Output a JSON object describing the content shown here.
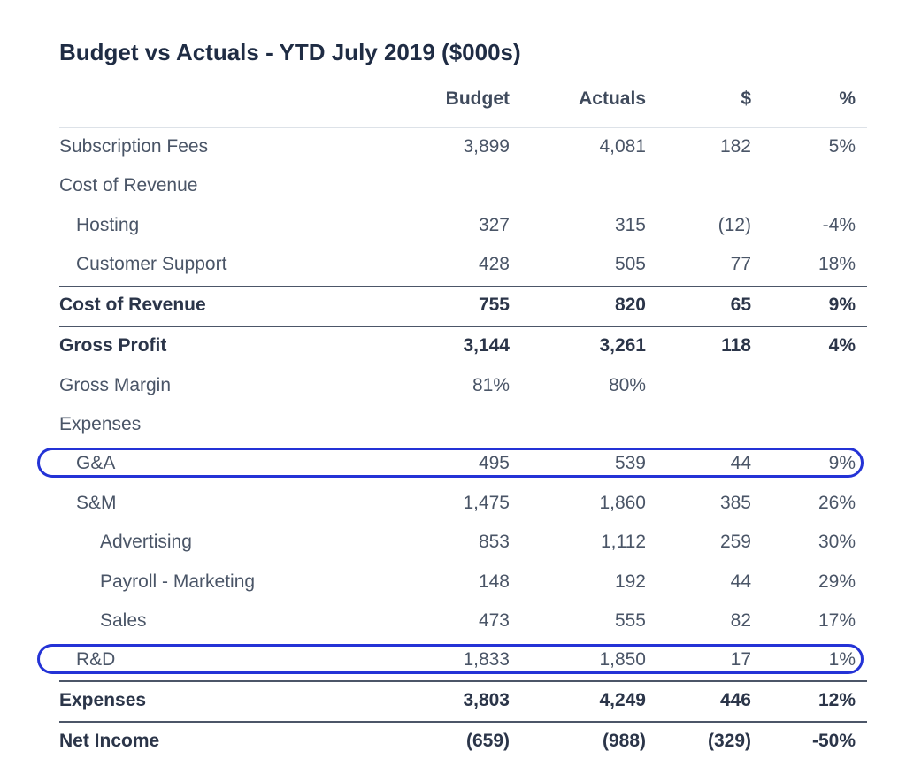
{
  "title": "Budget vs Actuals - YTD July 2019 ($000s)",
  "columns": {
    "budget": "Budget",
    "actuals": "Actuals",
    "diff": "$",
    "pct": "%"
  },
  "rows": [
    {
      "label": "Subscription Fees",
      "budget": "3,899",
      "actuals": "4,081",
      "diff": "182",
      "pct": "5%"
    },
    {
      "label": "Cost of Revenue",
      "budget": "",
      "actuals": "",
      "diff": "",
      "pct": ""
    },
    {
      "label": "Hosting",
      "budget": "327",
      "actuals": "315",
      "diff": "(12)",
      "pct": "-4%"
    },
    {
      "label": "Customer Support",
      "budget": "428",
      "actuals": "505",
      "diff": "77",
      "pct": "18%"
    },
    {
      "label": "Cost of Revenue",
      "budget": "755",
      "actuals": "820",
      "diff": "65",
      "pct": "9%"
    },
    {
      "label": "Gross Profit",
      "budget": "3,144",
      "actuals": "3,261",
      "diff": "118",
      "pct": "4%"
    },
    {
      "label": "Gross Margin",
      "budget": "81%",
      "actuals": "80%",
      "diff": "",
      "pct": ""
    },
    {
      "label": "Expenses",
      "budget": "",
      "actuals": "",
      "diff": "",
      "pct": ""
    },
    {
      "label": "G&A",
      "budget": "495",
      "actuals": "539",
      "diff": "44",
      "pct": "9%"
    },
    {
      "label": "S&M",
      "budget": "1,475",
      "actuals": "1,860",
      "diff": "385",
      "pct": "26%"
    },
    {
      "label": "Advertising",
      "budget": "853",
      "actuals": "1,112",
      "diff": "259",
      "pct": "30%"
    },
    {
      "label": "Payroll - Marketing",
      "budget": "148",
      "actuals": "192",
      "diff": "44",
      "pct": "29%"
    },
    {
      "label": "Sales",
      "budget": "473",
      "actuals": "555",
      "diff": "82",
      "pct": "17%"
    },
    {
      "label": "R&D",
      "budget": "1,833",
      "actuals": "1,850",
      "diff": "17",
      "pct": "1%"
    },
    {
      "label": "Expenses",
      "budget": "3,803",
      "actuals": "4,249",
      "diff": "446",
      "pct": "12%"
    },
    {
      "label": "Net Income",
      "budget": "(659)",
      "actuals": "(988)",
      "diff": "(329)",
      "pct": "-50%"
    }
  ],
  "colors": {
    "highlight": "#2433d6",
    "title": "#1f2c44",
    "text": "#4a5567",
    "rule": "#4c5668"
  }
}
